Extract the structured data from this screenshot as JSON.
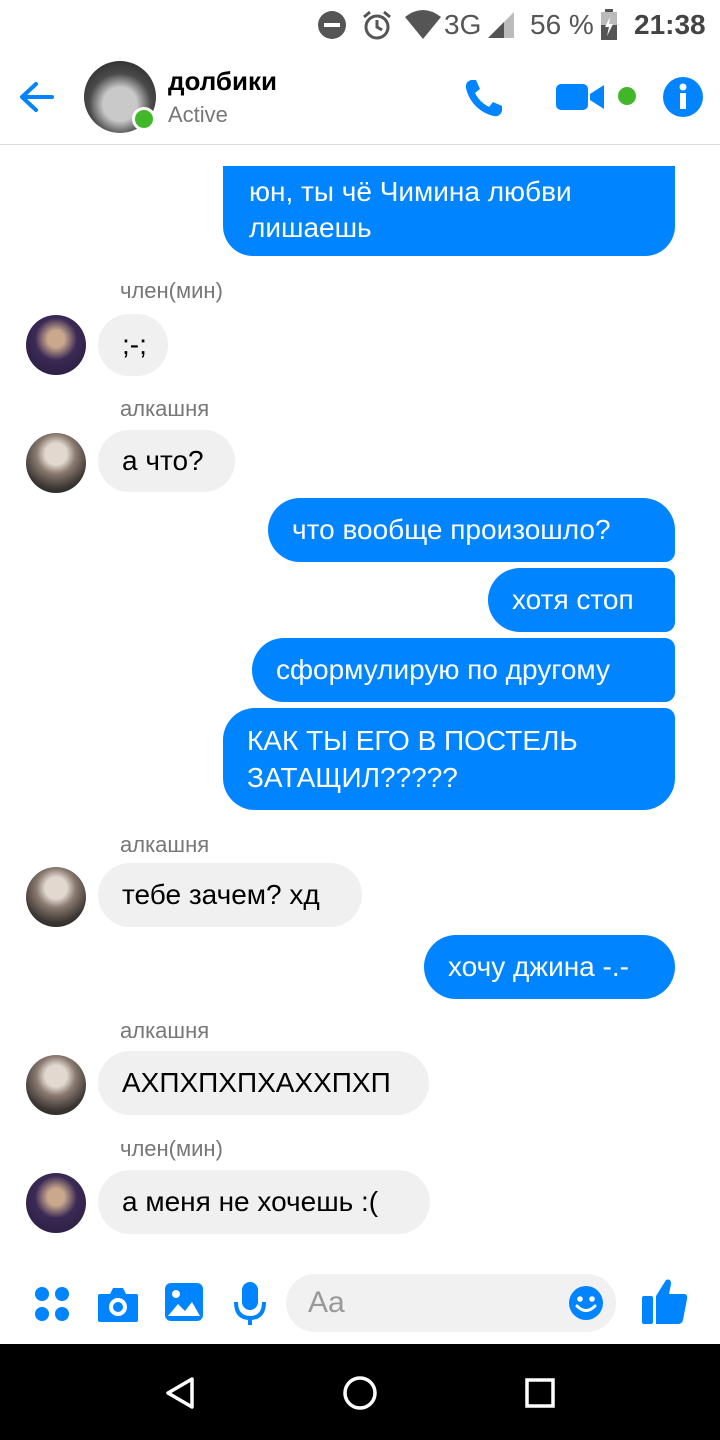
{
  "status_bar": {
    "network": "3G",
    "battery": "56 %",
    "time": "21:38"
  },
  "header": {
    "title": "долбики",
    "status": "Active"
  },
  "colors": {
    "accent": "#0084ff",
    "active_green": "#42b72a",
    "incoming_bubble": "#f0f0f0"
  },
  "messages": [
    {
      "direction": "out",
      "text": "юн, ты чё Чимина любви\nлишаешь"
    },
    {
      "sender": "член(мин)"
    },
    {
      "direction": "in",
      "text": ";-;"
    },
    {
      "sender": "алкашня"
    },
    {
      "direction": "in",
      "text": "а что?"
    },
    {
      "direction": "out",
      "text": "что вообще произошло?"
    },
    {
      "direction": "out",
      "text": "хотя стоп"
    },
    {
      "direction": "out",
      "text": "сформулирую по другому"
    },
    {
      "direction": "out",
      "text": "КАК ТЫ ЕГО В ПОСТЕЛЬ\nЗАТАЩИЛ?????"
    },
    {
      "sender": "алкашня"
    },
    {
      "direction": "in",
      "text": "тебе зачем? хд"
    },
    {
      "direction": "out",
      "text": "хочу джина -.-"
    },
    {
      "sender": "алкашня"
    },
    {
      "direction": "in",
      "text": "АХПХПХПХАХХПХП"
    },
    {
      "sender": "член(мин)"
    },
    {
      "direction": "in",
      "text": "а меня не хочешь :("
    }
  ],
  "composer": {
    "placeholder": "Aa",
    "icons": [
      "more-apps-icon",
      "camera-icon",
      "gallery-icon",
      "microphone-icon",
      "emoji-icon",
      "thumbs-up-icon"
    ]
  },
  "nav": {
    "icons": [
      "back-triangle-icon",
      "home-circle-icon",
      "recents-square-icon"
    ]
  }
}
